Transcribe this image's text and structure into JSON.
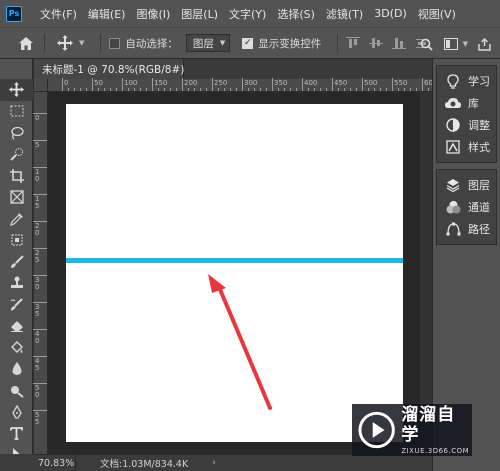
{
  "app": {
    "logo_text": "Ps"
  },
  "menu": [
    "文件(F)",
    "编辑(E)",
    "图像(I)",
    "图层(L)",
    "文字(Y)",
    "选择(S)",
    "滤镜(T)",
    "3D(D)",
    "视图(V)"
  ],
  "options": {
    "auto_select_label": "自动选择：",
    "auto_select_checked": false,
    "layer_select_value": "图层",
    "show_transform_label": "显示变换控件",
    "show_transform_checked": true
  },
  "document": {
    "tab_title": "未标题-1 @ 70.8%(RGB/8#) *",
    "close_glyph": "×"
  },
  "ruler": {
    "h_ticks": [
      "50",
      "0",
      "50",
      "100",
      "150",
      "200",
      "250",
      "300",
      "350",
      "400",
      "450",
      "500",
      "550",
      "600"
    ],
    "v_ticks": [
      "5",
      "0",
      "5",
      "1 0",
      "1 5",
      "2 0",
      "2 5",
      "3 0",
      "3 5",
      "4 0",
      "4 5",
      "5 0",
      "5 5"
    ]
  },
  "status": {
    "zoom": "70.83%",
    "doc_info": "文档:1.03M/834.4K",
    "caret": "›"
  },
  "panels": {
    "group1": [
      {
        "icon": "bulb-icon",
        "label": "学习"
      },
      {
        "icon": "library-icon",
        "label": "库"
      },
      {
        "icon": "adjustments-icon",
        "label": "调整"
      },
      {
        "icon": "styles-icon",
        "label": "样式"
      }
    ],
    "group2": [
      {
        "icon": "layers-icon",
        "label": "图层"
      },
      {
        "icon": "channels-icon",
        "label": "通道"
      },
      {
        "icon": "paths-icon",
        "label": "路径"
      }
    ]
  },
  "canvas": {
    "line_color": "#1ab9e6",
    "background": "#ffffff"
  },
  "watermark": {
    "title": "溜溜自学",
    "subtitle": "ZIXUE.3D66.COM"
  },
  "annotation": {
    "arrow_color": "#e8383d"
  }
}
